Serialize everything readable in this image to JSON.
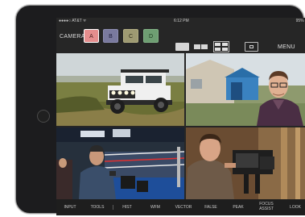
{
  "status_bar": {
    "carrier": "●●●●○ AT&T ᯤ",
    "time": "6:12 PM",
    "battery": "95% ▬"
  },
  "top_bar": {
    "camera_label": "CAMERA",
    "camera_buttons": [
      {
        "label": "A",
        "color": "#e58e8e",
        "selected": true
      },
      {
        "label": "B",
        "color": "#7a7a9e",
        "selected": false
      },
      {
        "label": "C",
        "color": "#9e9a72",
        "selected": false
      },
      {
        "label": "D",
        "color": "#6e9e72",
        "selected": false
      }
    ],
    "view_modes": [
      "single-view-icon",
      "dual-view-icon",
      "quad-view-icon"
    ],
    "selected_view": "quad-view-icon",
    "record_icon": "record-icon",
    "menu_label": "MENU"
  },
  "tools": [
    {
      "label": "INPUT"
    },
    {
      "label": "TOOLS"
    },
    {
      "label": "HIST"
    },
    {
      "label": "WFM"
    },
    {
      "label": "VECTOR"
    },
    {
      "label": "FALSE"
    },
    {
      "label": "PEAK"
    },
    {
      "label": "FOCUS ASSIST"
    },
    {
      "label": "LOOK"
    }
  ],
  "colors": {
    "frame": "#1c1c1e",
    "screen_bg": "#262626",
    "toolbar_bg": "#1e1e1e",
    "text": "#c8c8c8"
  }
}
